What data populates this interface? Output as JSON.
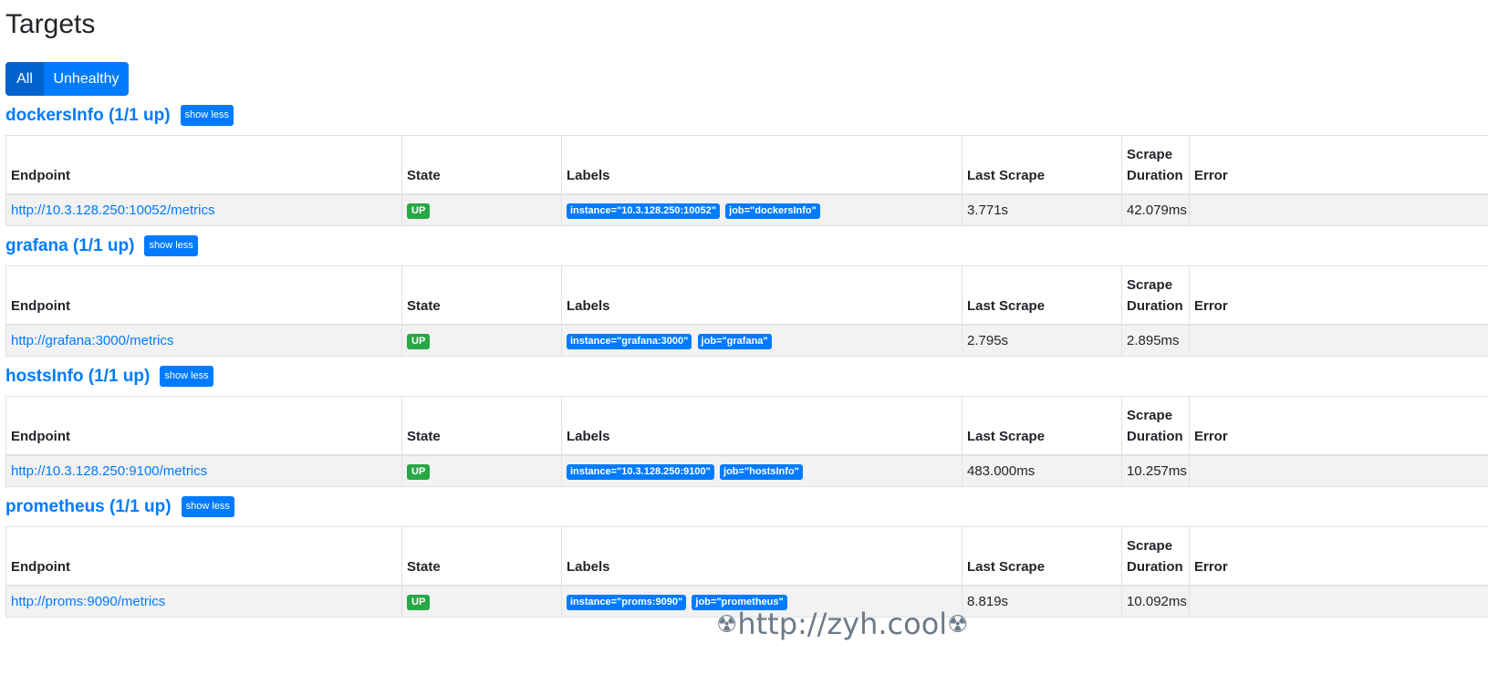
{
  "page": {
    "title": "Targets",
    "filters": {
      "all": "All",
      "unhealthy": "Unhealthy"
    }
  },
  "table_headers": {
    "endpoint": "Endpoint",
    "state": "State",
    "labels": "Labels",
    "last_scrape": "Last Scrape",
    "scrape_duration": "Scrape Duration",
    "error": "Error"
  },
  "show_less_label": "show less",
  "jobs": [
    {
      "name": "dockersInfo (1/1 up)",
      "endpoint": "http://10.3.128.250:10052/metrics",
      "state": "UP",
      "labels": [
        "instance=\"10.3.128.250:10052\"",
        "job=\"dockersInfo\""
      ],
      "last_scrape": "3.771s",
      "scrape_duration": "42.079ms",
      "error": ""
    },
    {
      "name": "grafana (1/1 up)",
      "endpoint": "http://grafana:3000/metrics",
      "state": "UP",
      "labels": [
        "instance=\"grafana:3000\"",
        "job=\"grafana\""
      ],
      "last_scrape": "2.795s",
      "scrape_duration": "2.895ms",
      "error": ""
    },
    {
      "name": "hostsInfo (1/1 up)",
      "endpoint": "http://10.3.128.250:9100/metrics",
      "state": "UP",
      "labels": [
        "instance=\"10.3.128.250:9100\"",
        "job=\"hostsInfo\""
      ],
      "last_scrape": "483.000ms",
      "scrape_duration": "10.257ms",
      "error": ""
    },
    {
      "name": "prometheus (1/1 up)",
      "endpoint": "http://proms:9090/metrics",
      "state": "UP",
      "labels": [
        "instance=\"proms:9090\"",
        "job=\"prometheus\""
      ],
      "last_scrape": "8.819s",
      "scrape_duration": "10.092ms",
      "error": ""
    }
  ],
  "watermark": {
    "icon_name": "radioactive-icon",
    "text": "http://zyh.cool"
  },
  "colors": {
    "primary": "#007bff",
    "active_filter": "#0062cc",
    "state_up": "#28a745"
  }
}
